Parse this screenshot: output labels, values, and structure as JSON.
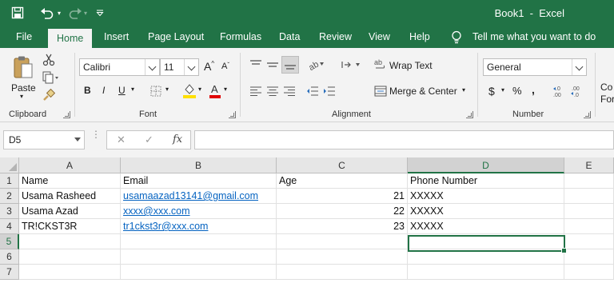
{
  "app": {
    "title": "Book1  -  Excel"
  },
  "tabs": {
    "file": "File",
    "home": "Home",
    "insert": "Insert",
    "page_layout": "Page Layout",
    "formulas": "Formulas",
    "data": "Data",
    "review": "Review",
    "view": "View",
    "help": "Help",
    "tell_me": "Tell me what you want to do"
  },
  "ribbon": {
    "clipboard": {
      "paste_label": "Paste",
      "group_label": "Clipboard"
    },
    "font": {
      "font_name": "Calibri",
      "font_size": "11",
      "bold": "B",
      "italic": "I",
      "underline": "U",
      "grow": "A",
      "shrink": "A",
      "group_label": "Font"
    },
    "alignment": {
      "wrap_text": "Wrap Text",
      "merge_center": "Merge & Center",
      "group_label": "Alignment"
    },
    "number": {
      "format": "General",
      "currency": "$",
      "percent": "%",
      "comma": ",",
      "group_label": "Number"
    },
    "styles": {
      "cond_line1": "Co",
      "cond_line2": "For"
    }
  },
  "formula_bar": {
    "name_box": "D5",
    "cancel": "✕",
    "enter": "✓",
    "fx": "fx",
    "formula": ""
  },
  "sheet": {
    "columns": [
      "A",
      "B",
      "C",
      "D",
      "E"
    ],
    "rows": [
      "1",
      "2",
      "3",
      "4",
      "5",
      "6",
      "7"
    ],
    "cells": {
      "A1": "Name",
      "B1": "Email",
      "C1": "Age",
      "D1": "Phone Number",
      "A2": "Usama Rasheed",
      "B2": "usamaazad13141@gmail.com",
      "C2": "21",
      "D2": "XXXXX",
      "A3": "Usama Azad",
      "B3": "xxxx@xxx.com",
      "C3": "22",
      "D3": "XXXXX",
      "A4": "TR!CKST3R",
      "B4": "tr1ckst3r@xxx.com",
      "C4": "23",
      "D4": "XXXXX"
    },
    "active_cell": "D5"
  },
  "colors": {
    "brand": "#217346",
    "hyperlink": "#0563c1",
    "ribbon_bg": "#f3f3f3",
    "header_bg": "#e6e6e6"
  },
  "icons": {
    "save": "save-icon",
    "undo": "undo-icon",
    "redo": "redo-icon",
    "customize": "customize-qat-icon",
    "tell_me": "lightbulb-icon",
    "paste": "clipboard-paste-icon",
    "cut": "scissors-icon",
    "copy": "copy-icon",
    "format_painter": "paintbrush-icon"
  }
}
